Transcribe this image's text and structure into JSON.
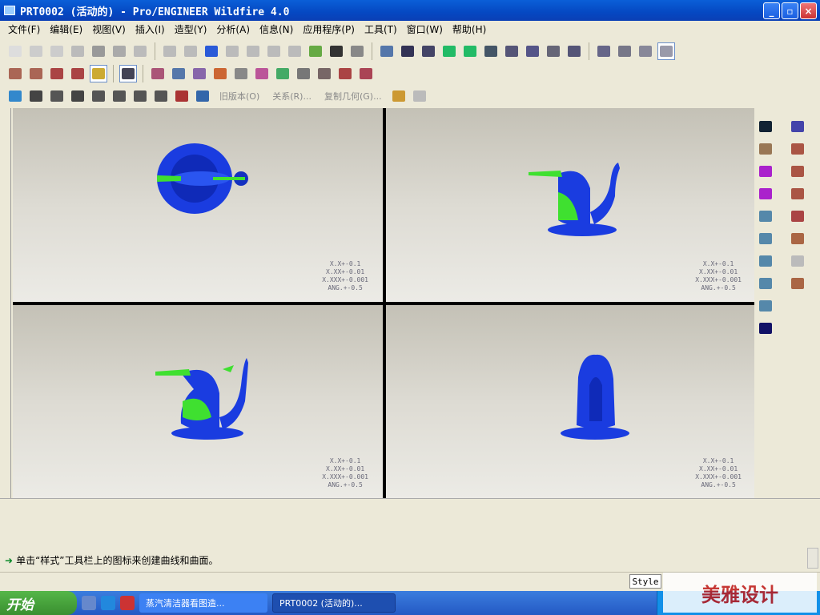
{
  "window": {
    "title": "PRT0002 (活动的) - Pro/ENGINEER Wildfire 4.0",
    "min": "_",
    "max": "▫",
    "close": "×"
  },
  "menu": [
    "文件(F)",
    "编辑(E)",
    "视图(V)",
    "插入(I)",
    "造型(Y)",
    "分析(A)",
    "信息(N)",
    "应用程序(P)",
    "工具(T)",
    "窗口(W)",
    "帮助(H)"
  ],
  "toolbar3_text": [
    "旧版本(O)",
    "关系(R)...",
    "复制几何(G)..."
  ],
  "viewports": [
    {
      "name": "top",
      "tol": [
        "X.X+-0.1",
        "X.XX+-0.01",
        "X.XXX+-0.001",
        "ANG.+-0.5"
      ]
    },
    {
      "name": "right",
      "tol": [
        "X.X+-0.1",
        "X.XX+-0.01",
        "X.XXX+-0.001",
        "ANG.+-0.5"
      ]
    },
    {
      "name": "front",
      "tol": [
        "X.X+-0.1",
        "X.XX+-0.01",
        "X.XXX+-0.001",
        "ANG.+-0.5"
      ]
    },
    {
      "name": "back",
      "tol": [
        "X.X+-0.1",
        "X.XX+-0.01",
        "X.XXX+-0.001",
        "ANG.+-0.5"
      ]
    }
  ],
  "message": "单击“样式”工具栏上的图标来创建曲线和曲面。",
  "style_box": "Style",
  "taskbar": {
    "start": "开始",
    "tasks": [
      "蒸汽清洁器看图造...",
      "PRT0002 (活动的)..."
    ]
  },
  "watermark": "美雅设计",
  "colors": {
    "model_blue": "#1a3ce0",
    "model_green": "#3fe030",
    "title_blue": "#0548c2"
  }
}
